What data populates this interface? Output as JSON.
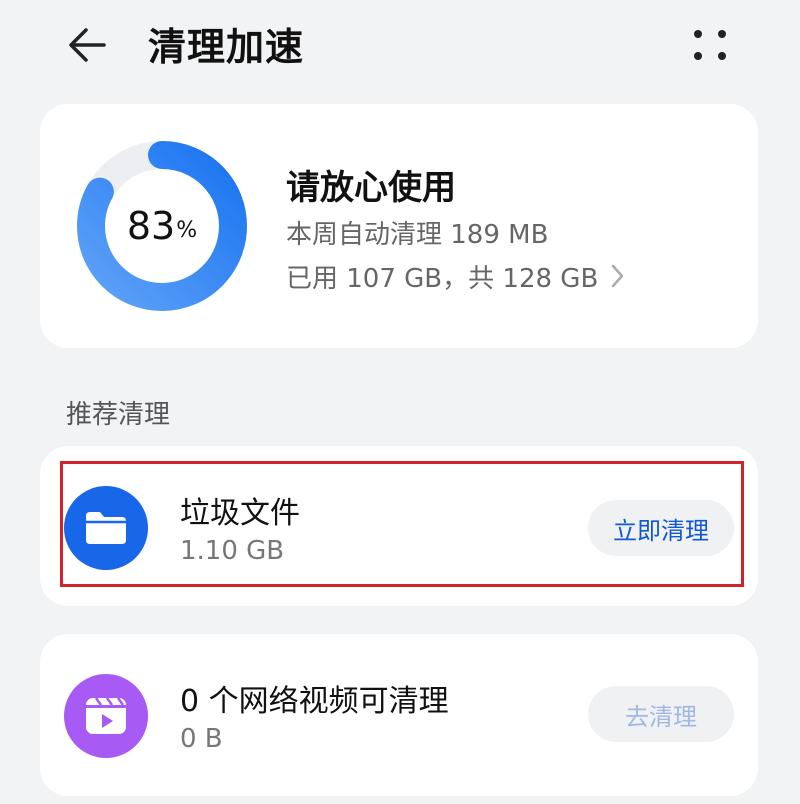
{
  "header": {
    "title": "清理加速"
  },
  "storage": {
    "percent": "83",
    "percent_unit": "%",
    "used_fraction": 0.83,
    "status": "请放心使用",
    "auto_clean": "本周自动清理 189 MB",
    "usage": "已用 107 GB，共 128 GB"
  },
  "section_label": "推荐清理",
  "items": [
    {
      "title": "垃圾文件",
      "size": "1.10 GB",
      "action": "立即清理",
      "icon": "folder-icon",
      "color": "#1867e8"
    },
    {
      "title": "0 个网络视频可清理",
      "size": "0 B",
      "action": "去清理",
      "icon": "video-clip-icon",
      "color": "#a85af5"
    }
  ],
  "colors": {
    "accent": "#1867e8",
    "highlight": "#d2232a",
    "disabled_text": "#9fb8e6"
  }
}
